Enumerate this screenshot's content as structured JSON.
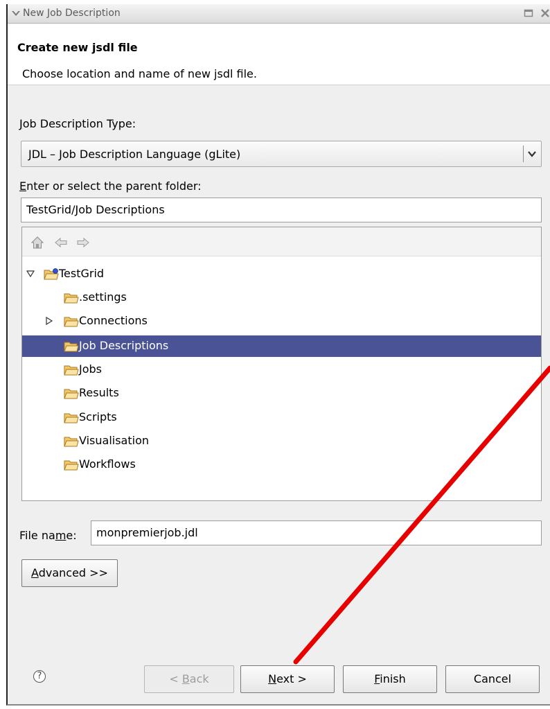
{
  "window": {
    "title": "New Job Description"
  },
  "header": {
    "title": "Create new jsdl file",
    "description": "Choose location and name of new jsdl file."
  },
  "job_type": {
    "label_prefix": "J",
    "label_rest": "ob Description Type:",
    "selected": "JDL – Job Description Language (gLite)"
  },
  "parent_folder": {
    "label_prefix": "E",
    "label_rest": "nter or select the parent folder:",
    "value": "TestGrid/Job Descriptions"
  },
  "tree": {
    "toolbar_icons": [
      "home-icon",
      "back-arrow-icon",
      "forward-arrow-icon"
    ],
    "root": "TestGrid",
    "items": [
      ".settings",
      "Connections",
      "Job Descriptions",
      "Jobs",
      "Results",
      "Scripts",
      "Visualisation",
      "Workflows"
    ],
    "selected": "Job Descriptions"
  },
  "file_name": {
    "label_pre": "File na",
    "label_mnemonic": "m",
    "label_post": "e:",
    "value": "monpremierjob.jdl"
  },
  "buttons": {
    "advanced_mnemonic": "A",
    "advanced_rest": "dvanced >>",
    "back_pre": "< ",
    "back_mnemonic": "B",
    "back_rest": "ack",
    "next_mnemonic": "N",
    "next_rest": "ext >",
    "finish_mnemonic": "F",
    "finish_rest": "inish",
    "cancel": "Cancel",
    "help_glyph": "?"
  },
  "colors": {
    "selection": "#4a5396",
    "folder": "#f2c66a",
    "annotation_arrow": "#e60000"
  }
}
